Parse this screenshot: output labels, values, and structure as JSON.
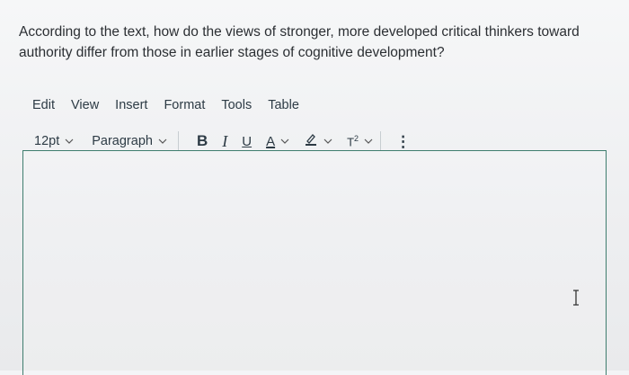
{
  "question": {
    "text": "According to the text, how do the views of stronger, more developed critical thinkers toward authority differ from those in earlier stages of cognitive development?"
  },
  "menubar": {
    "items": [
      {
        "label": "Edit"
      },
      {
        "label": "View"
      },
      {
        "label": "Insert"
      },
      {
        "label": "Format"
      },
      {
        "label": "Tools"
      },
      {
        "label": "Table"
      }
    ]
  },
  "toolbar": {
    "font_size": "12pt",
    "block_format": "Paragraph",
    "bold_label": "B",
    "italic_label": "I",
    "underline_label": "U",
    "font_color_label": "A",
    "superscript_label": "T",
    "superscript_sup": "2",
    "more_label": "⋮"
  },
  "editor": {
    "content": ""
  },
  "colors": {
    "editor_border": "#3f7d6e",
    "text": "#2d3b45"
  },
  "icons": {
    "chevron": "chevron-down-icon",
    "highlight": "highlighter-icon",
    "cursor": "text-cursor-icon"
  }
}
